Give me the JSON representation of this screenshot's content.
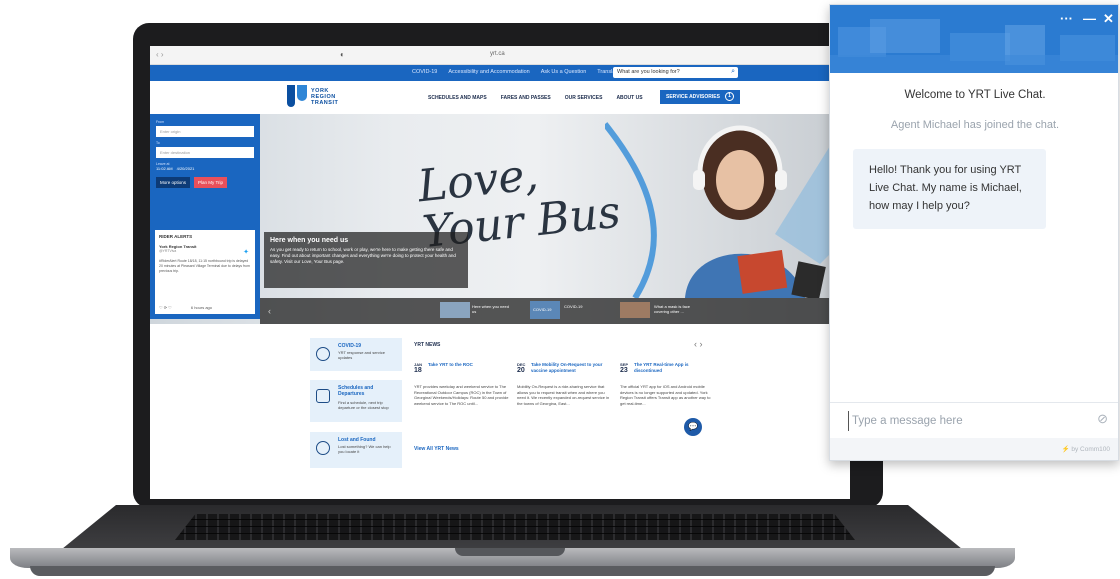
{
  "browser": {
    "url": "yrt.ca",
    "nav_arrows": "‹ ›",
    "favicon_glyph": "◐"
  },
  "site": {
    "utility_links": [
      "COVID-19",
      "Accessibility and Accommodation",
      "Ask Us a Question",
      "Translate"
    ],
    "search_placeholder": "What are you looking for?",
    "logo_lines": [
      "YORK",
      "REGION",
      "TRANSIT"
    ],
    "nav_items": [
      "SCHEDULES AND MAPS",
      "FARES AND PASSES",
      "OUR SERVICES",
      "ABOUT US"
    ],
    "advisories_label": "SERVICE ADVISORIES",
    "advisories_count": "1",
    "colors": {
      "brand_blue": "#1a66c0",
      "navy": "#0b4fa0",
      "accent_red": "#e9505b",
      "chat_header": "#2b7bd1"
    }
  },
  "planner": {
    "from_label": "From",
    "from_placeholder": "Enter origin",
    "to_label": "To",
    "to_placeholder": "Enter destination",
    "leave_label": "Leave at",
    "time_value": "11:02 AM",
    "date_value": "4/20/2021",
    "more_options": "More options",
    "plan_trip": "Plan My Trip"
  },
  "alerts": {
    "heading": "RIDER ALERTS",
    "account_name": "York Region Transit",
    "account_handle": "@YRTViva",
    "tweet": "#RiderAlert Route 18/18, 11:15 northbound trip is delayed 20 minutes at Pleasant Village Terminal due to delays from previous trip.",
    "time": "6 hours ago",
    "actions": "♡ ⟳ ♡"
  },
  "hero": {
    "title_line1": "Love,",
    "title_line2": "Your Bus",
    "panel_heading": "Here when you need us",
    "panel_text": "As you get ready to return to school, work or play, we're here to make getting there safe and easy. Find out about important changes and everything we're doing to protect your health and safety. Visit our Love, Your Bus page.",
    "slides": [
      "Here when you need us",
      "COVID-19",
      "What a mask is face covering other ..."
    ],
    "covid_slide_label": "COVID-19",
    "prev_arrow": "‹"
  },
  "services": [
    {
      "title": "COVID-19",
      "desc": "YRT response and service updates"
    },
    {
      "title": "Schedules and Departures",
      "desc": "Find a schedule, next trip departure or the closest stop"
    },
    {
      "title": "Lost and Found",
      "desc": "Lost something? We can help you locate it"
    }
  ],
  "news": {
    "heading": "YRT NEWS",
    "nav": "‹  ›",
    "view_all": "View All YRT News",
    "articles": [
      {
        "month": "JAN",
        "day": "18",
        "title": "Take YRT to the ROC",
        "body": "YRT provides weekday and weekend service to The Recreational Outdoor Campus (ROC) in the Town of Georgina! Weekends/Holidays: Route 50 and provide weekend service to The ROC until..."
      },
      {
        "month": "DEC",
        "day": "20",
        "title": "Take Mobility On-Request to your vaccine appointment",
        "body": "Mobility On-Request is a ride-sharing service that allows you to request transit when and where you need it. We recently expanded on-request service in the towns of Georgina, East..."
      },
      {
        "month": "SEP",
        "day": "23",
        "title": "The YRT Real-time App is discontinued",
        "body": "The official YRT app for iOS and Android mobile devices is no longer supported and updated. York Region Transit offers Transit app as another way to get real-time..."
      }
    ]
  },
  "chat": {
    "controls": {
      "menu": "···",
      "minimize": "—",
      "close": "✕"
    },
    "welcome": "Welcome to YRT Live Chat.",
    "joined": "Agent Michael has joined the chat.",
    "agent_message": "Hello! Thank you for using YRT Live Chat. My name is Michael, how may I help you?",
    "input_placeholder": "Type a message here",
    "attach_glyph": "⊘",
    "powered_by": "by Comm100",
    "bolt": "⚡",
    "launcher_glyph": "💬"
  }
}
